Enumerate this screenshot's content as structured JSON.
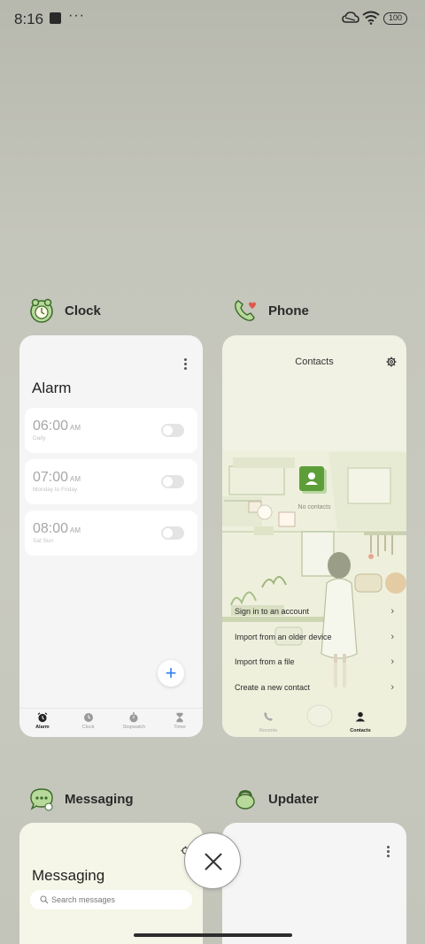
{
  "status_bar": {
    "time": "8:16",
    "overflow": "···",
    "battery": "100"
  },
  "recents": {
    "clock": {
      "app_name": "Clock",
      "screen_title": "Alarm",
      "alarms": [
        {
          "time": "06:00",
          "ampm": "AM",
          "repeat": "Daily",
          "enabled": false
        },
        {
          "time": "07:00",
          "ampm": "AM",
          "repeat": "Monday to Friday",
          "enabled": false
        },
        {
          "time": "08:00",
          "ampm": "AM",
          "repeat": "Sat Sun",
          "enabled": false
        }
      ],
      "tabs": [
        {
          "label": "Alarm",
          "icon": "alarm-icon",
          "active": true
        },
        {
          "label": "Clock",
          "icon": "clock-icon",
          "active": false
        },
        {
          "label": "Stopwatch",
          "icon": "stopwatch-icon",
          "active": false
        },
        {
          "label": "Timer",
          "icon": "timer-icon",
          "active": false
        }
      ],
      "add_button": "+"
    },
    "phone": {
      "app_name": "Phone",
      "screen_title": "Contacts",
      "empty_text": "No contacts",
      "import_options": [
        "Sign in to an account",
        "Import from an older device",
        "Import from a file",
        "Create a new contact"
      ],
      "tabs": [
        {
          "label": "Recents",
          "icon": "phone-icon",
          "active": false
        },
        {
          "label": "Contacts",
          "icon": "person-icon",
          "active": true
        }
      ]
    },
    "messaging": {
      "app_name": "Messaging",
      "screen_title": "Messaging",
      "search_placeholder": "Search messages"
    },
    "updater": {
      "app_name": "Updater"
    }
  },
  "colors": {
    "accent_blue": "#2e7ef0",
    "contacts_green": "#5e9e3a"
  }
}
